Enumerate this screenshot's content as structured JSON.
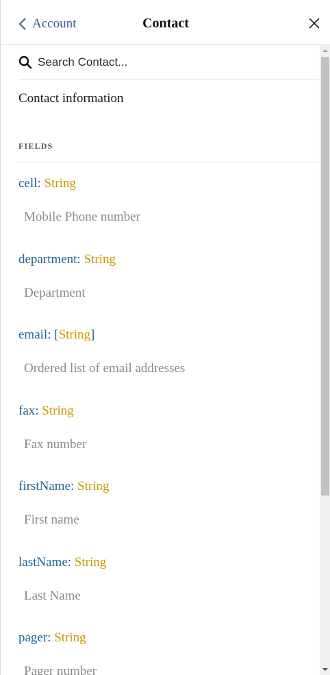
{
  "header": {
    "back_label": "Account",
    "title": "Contact",
    "close_icon": "close-icon",
    "back_icon": "chevron-left-icon"
  },
  "search": {
    "placeholder": "Search Contact...",
    "value": "",
    "icon": "search-icon"
  },
  "type_description": "Contact information",
  "section_label": "FIELDS",
  "fields": [
    {
      "name": "cell",
      "type": "String",
      "list": false,
      "description": "Mobile Phone number"
    },
    {
      "name": "department",
      "type": "String",
      "list": false,
      "description": "Department"
    },
    {
      "name": "email",
      "type": "String",
      "list": true,
      "description": "Ordered list of email addresses"
    },
    {
      "name": "fax",
      "type": "String",
      "list": false,
      "description": "Fax number"
    },
    {
      "name": "firstName",
      "type": "String",
      "list": false,
      "description": "First name"
    },
    {
      "name": "lastName",
      "type": "String",
      "list": false,
      "description": "Last Name"
    },
    {
      "name": "pager",
      "type": "String",
      "list": false,
      "description": "Pager number"
    }
  ],
  "colors": {
    "field_name": "#1f61a0",
    "field_type": "#ca9800",
    "description": "#8a8a8a",
    "back_link": "#3d5a98"
  }
}
